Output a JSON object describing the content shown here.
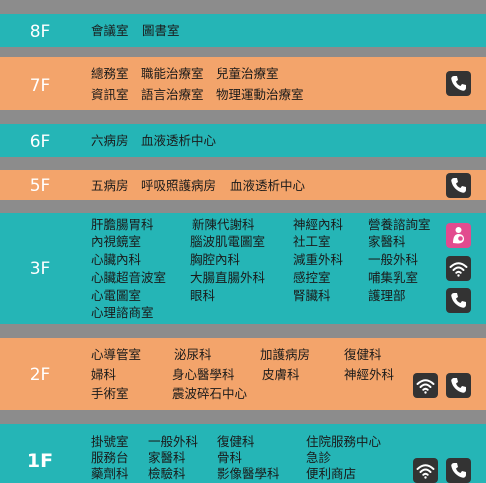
{
  "floors": {
    "f8": {
      "label": "8F",
      "items": [
        "會議室",
        "圖書室"
      ]
    },
    "f7": {
      "label": "7F",
      "row1": [
        "總務室",
        "職能治療室",
        "兒童治療室"
      ],
      "row2": [
        "資訊室",
        "語言治療室",
        "物理運動治療室"
      ],
      "icons": [
        "phone-icon"
      ]
    },
    "f6": {
      "label": "6F",
      "items": [
        "六病房",
        "血液透析中心"
      ]
    },
    "f5": {
      "label": "5F",
      "items": [
        "五病房",
        "呼吸照護病房",
        "血液透析中心"
      ],
      "icons": [
        "phone-icon"
      ]
    },
    "f3": {
      "label": "3F",
      "col1": [
        "肝膽腸胃科",
        "內視鏡室",
        "心臟內科",
        "心臟超音波室",
        "心電圖室",
        "心理諮商室"
      ],
      "col2": [
        "新陳代謝科",
        "腦波肌電圖室",
        "胸腔內科",
        "大腸直腸外科",
        "眼科"
      ],
      "col3": [
        "神經內科",
        "社工室",
        "減重外科",
        "感控室",
        "腎臟科"
      ],
      "col4": [
        "營養諮詢室",
        "家醫科",
        "一般外科",
        "哺集乳室",
        "護理部"
      ],
      "icons": [
        "nursing-room-icon",
        "wifi-icon",
        "phone-icon"
      ]
    },
    "f2": {
      "label": "2F",
      "row1": [
        "心導管室",
        "泌尿科",
        "加護病房",
        "復健科"
      ],
      "row2": [
        "婦科",
        "身心醫學科",
        "皮膚科",
        "神經外科"
      ],
      "row3": [
        "手術室",
        "震波碎石中心"
      ],
      "icons": [
        "wifi-icon",
        "phone-icon"
      ]
    },
    "f1": {
      "label": "1F",
      "row1": [
        "掛號室",
        "一般外科",
        "復健科",
        "住院服務中心"
      ],
      "row2": [
        "服務台",
        "家醫科",
        "骨科",
        "急診"
      ],
      "row3": [
        "藥劑科",
        "檢驗科",
        "影像醫學科",
        "便利商店"
      ],
      "icons": [
        "wifi-icon",
        "phone-icon"
      ]
    }
  },
  "colors": {
    "teal": "#25b5b6",
    "orange": "#f3a46b",
    "gap": "#8c8c8c",
    "icon_bg": "#333333",
    "icon_pink": "#e24b8f"
  }
}
